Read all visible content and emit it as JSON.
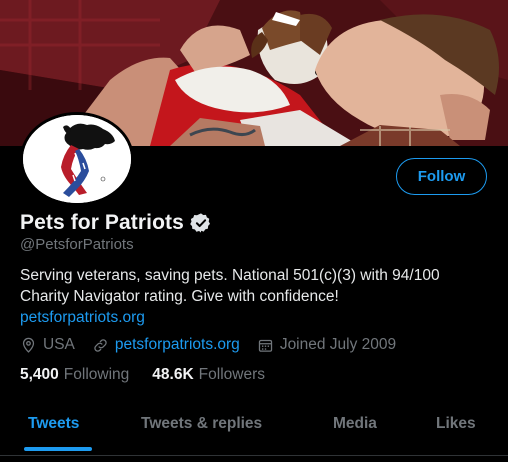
{
  "profile": {
    "display_name": "Pets for Patriots",
    "handle": "@PetsforPatriots",
    "bio_text": "Serving veterans, saving pets. National 501(c)(3) with 94/100 Charity Navigator rating. Give with confidence!",
    "bio_link": "petsforpatriots.org",
    "location": "USA",
    "website": "petsforpatriots.org",
    "joined": "Joined July 2009",
    "verified": true
  },
  "actions": {
    "follow_label": "Follow"
  },
  "stats": {
    "following_count": "5,400",
    "following_label": "Following",
    "followers_count": "48.6K",
    "followers_label": "Followers"
  },
  "tabs": [
    {
      "label": "Tweets",
      "active": true
    },
    {
      "label": "Tweets & replies",
      "active": false
    },
    {
      "label": "Media",
      "active": false
    },
    {
      "label": "Likes",
      "active": false
    }
  ],
  "colors": {
    "accent": "#1d9bf0",
    "background": "#000000",
    "muted_text": "#71767b",
    "primary_text": "#e7e9ea"
  },
  "icons": {
    "verified": "verified-badge-icon",
    "location": "location-pin-icon",
    "link": "link-icon",
    "calendar": "calendar-icon"
  }
}
